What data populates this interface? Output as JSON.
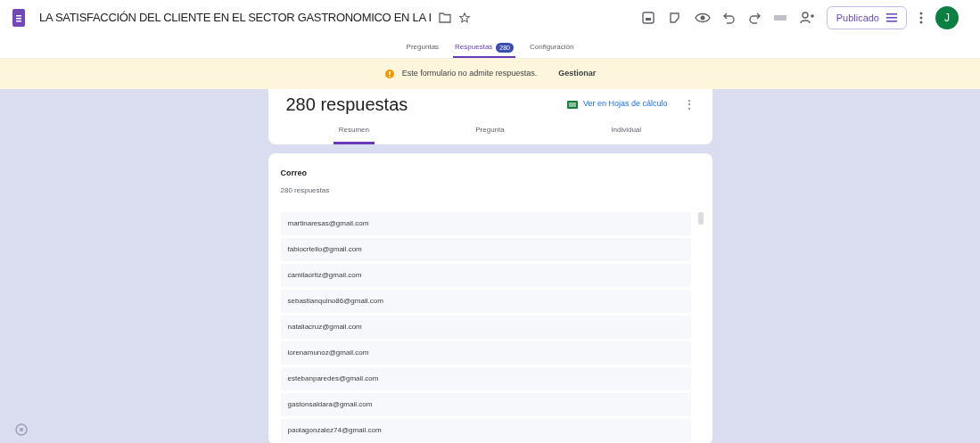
{
  "document": {
    "title": "LA SATISFACCIÓN DEL CLIENTE EN EL SECTOR GASTRONOMICO EN LA I"
  },
  "toolbar": {
    "publish_button": "Publicado",
    "avatar": "J"
  },
  "tabs": [
    {
      "label": "Preguntas",
      "selected": false
    },
    {
      "label": "Respuestas",
      "badge": "280",
      "selected": true
    },
    {
      "label": "Configuración",
      "selected": false
    }
  ],
  "banner": {
    "message": "Este formulario no admite respuestas.",
    "action": "Gestionar"
  },
  "summary": {
    "title": "280 respuestas",
    "sheets_link": "Ver en Hojas de cálculo",
    "more": "⋮",
    "view_tabs": [
      {
        "label": "Resumen",
        "selected": true
      },
      {
        "label": "Pregunta",
        "selected": false
      },
      {
        "label": "Individual",
        "selected": false
      }
    ]
  },
  "question": {
    "title": "Correo",
    "count": "280 respuestas",
    "answers": [
      "martinaresas@gmail.com",
      "fabiocrtello@gmail.com",
      "camilaortiz@gmail.com",
      "sebastianquino86@gmail.com",
      "nataliacruz@gmail.com",
      "lorenamunoz@gmail.com",
      "estebanparedes@gmail.com",
      "gastonsaldara@gmail.com",
      "paolagonzalez74@gmail.com"
    ]
  }
}
